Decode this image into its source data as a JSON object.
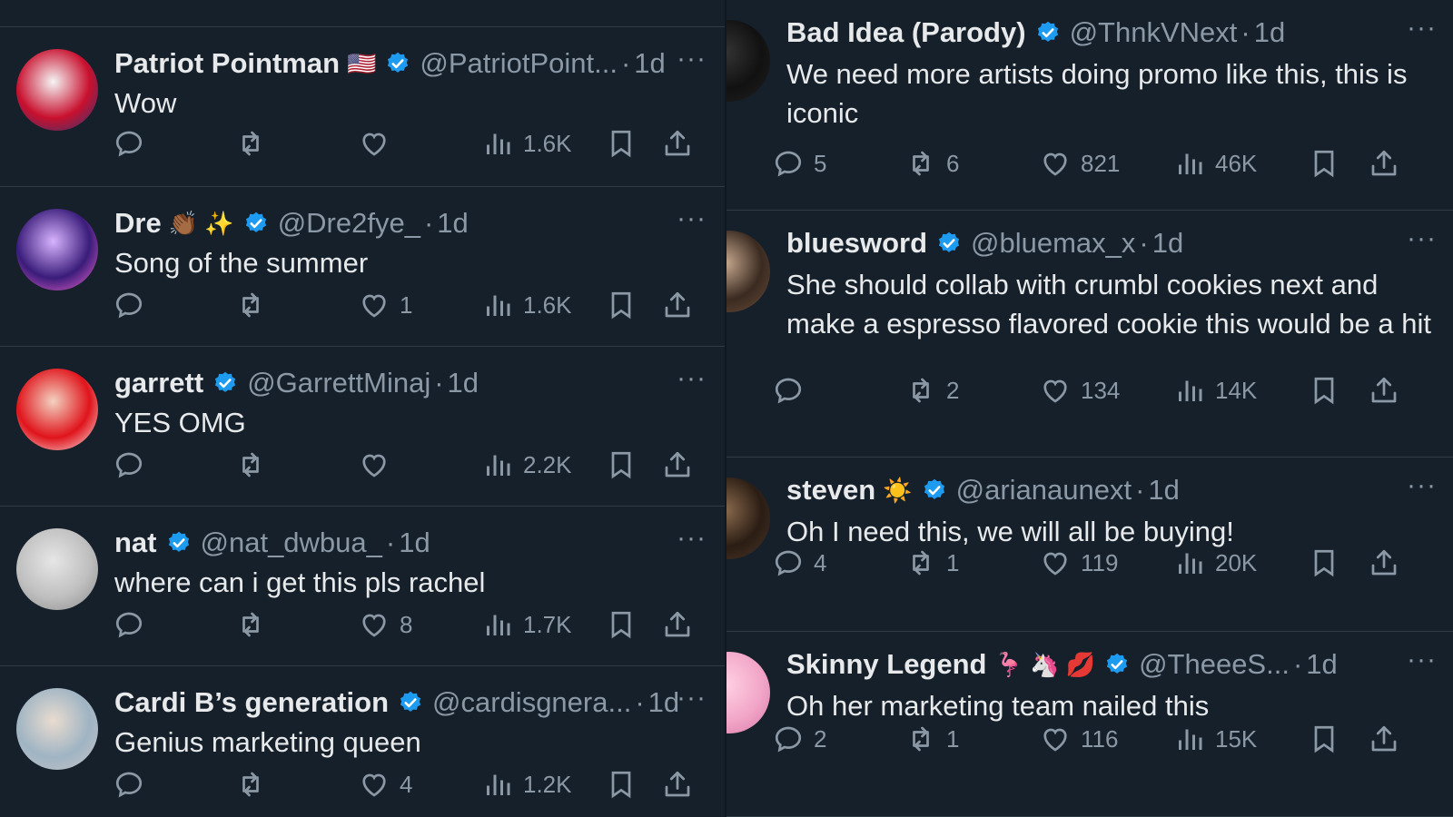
{
  "top_strip": "",
  "left_column": [
    {
      "name": "Patriot Pointman",
      "emoji": "🇺🇸",
      "handle": "@PatriotPoint...",
      "time": "1d",
      "text": "Wow",
      "replies": "",
      "reposts": "",
      "likes": "",
      "views": "1.6K",
      "avatar_colors": [
        "#c8102e",
        "#f5f5f5",
        "#1f3b7a"
      ]
    },
    {
      "name": "Dre",
      "emoji": "👏🏾 ✨",
      "handle": "@Dre2fye_",
      "time": "1d",
      "text": "Song of the summer",
      "replies": "",
      "reposts": "",
      "likes": "1",
      "views": "1.6K",
      "avatar_colors": [
        "#3a1c7a",
        "#d8b4ff",
        "#ff6ad5"
      ]
    },
    {
      "name": "garrett",
      "emoji": "",
      "handle": "@GarrettMinaj",
      "time": "1d",
      "text": "YES OMG",
      "replies": "",
      "reposts": "",
      "likes": "",
      "views": "2.2K",
      "avatar_colors": [
        "#e0141b",
        "#f3d2c1",
        "#f8f8f8"
      ]
    },
    {
      "name": "nat",
      "emoji": "",
      "handle": "@nat_dwbua_",
      "time": "1d",
      "text": "where can i get this pls rachel",
      "replies": "",
      "reposts": "",
      "likes": "8",
      "views": "1.7K",
      "avatar_colors": [
        "#bfbfbf",
        "#e6e6e6",
        "#8a8a8a"
      ]
    },
    {
      "name": "Cardi B’s generation",
      "emoji": "",
      "handle": "@cardisgnera...",
      "time": "1d",
      "text": "Genius marketing queen",
      "replies": "",
      "reposts": "",
      "likes": "4",
      "views": "1.2K",
      "avatar_colors": [
        "#9fb4c3",
        "#e9dcd0",
        "#c9c4c7"
      ]
    }
  ],
  "right_column": [
    {
      "name": "Bad Idea (Parody)",
      "emoji": "",
      "handle": "@ThnkVNext",
      "time": "1d",
      "text": "We need more artists doing promo like this, this is iconic",
      "replies": "5",
      "reposts": "6",
      "likes": "821",
      "views": "46K",
      "avatar_colors": [
        "#111111",
        "#333333",
        "#222222"
      ]
    },
    {
      "name": "bluesword",
      "emoji": "",
      "handle": "@bluemax_x",
      "time": "1d",
      "text": "She should collab with crumbl cookies next and make a espresso flavored cookie this would be a hit",
      "replies": "",
      "reposts": "2",
      "likes": "134",
      "views": "14K",
      "avatar_colors": [
        "#3a2a20",
        "#c7a98f",
        "#6b4f3b"
      ]
    },
    {
      "name": "steven",
      "emoji": "☀️",
      "handle": "@arianaunext",
      "time": "1d",
      "text": "Oh I need this, we will all be buying!",
      "replies": "4",
      "reposts": "1",
      "likes": "119",
      "views": "20K",
      "avatar_colors": [
        "#2b1d14",
        "#8a6a4d",
        "#4a3627"
      ]
    },
    {
      "name": "Skinny Legend",
      "emoji": "🦩 🦄 💋",
      "handle": "@TheeeS...",
      "time": "1d",
      "text": "Oh her marketing team nailed this",
      "replies": "2",
      "reposts": "1",
      "likes": "116",
      "views": "15K",
      "avatar_colors": [
        "#f2a6c8",
        "#ffd1e3",
        "#d87aa6"
      ]
    }
  ],
  "colors": {
    "background": "#15202b",
    "text": "#e7e9ea",
    "muted": "#8b98a5",
    "verified": "#1d9bf0",
    "divider": "#2f3b47"
  },
  "icons": [
    "reply-icon",
    "repost-icon",
    "like-icon",
    "views-icon",
    "bookmark-icon",
    "share-icon",
    "verified-badge-icon",
    "more-icon"
  ]
}
